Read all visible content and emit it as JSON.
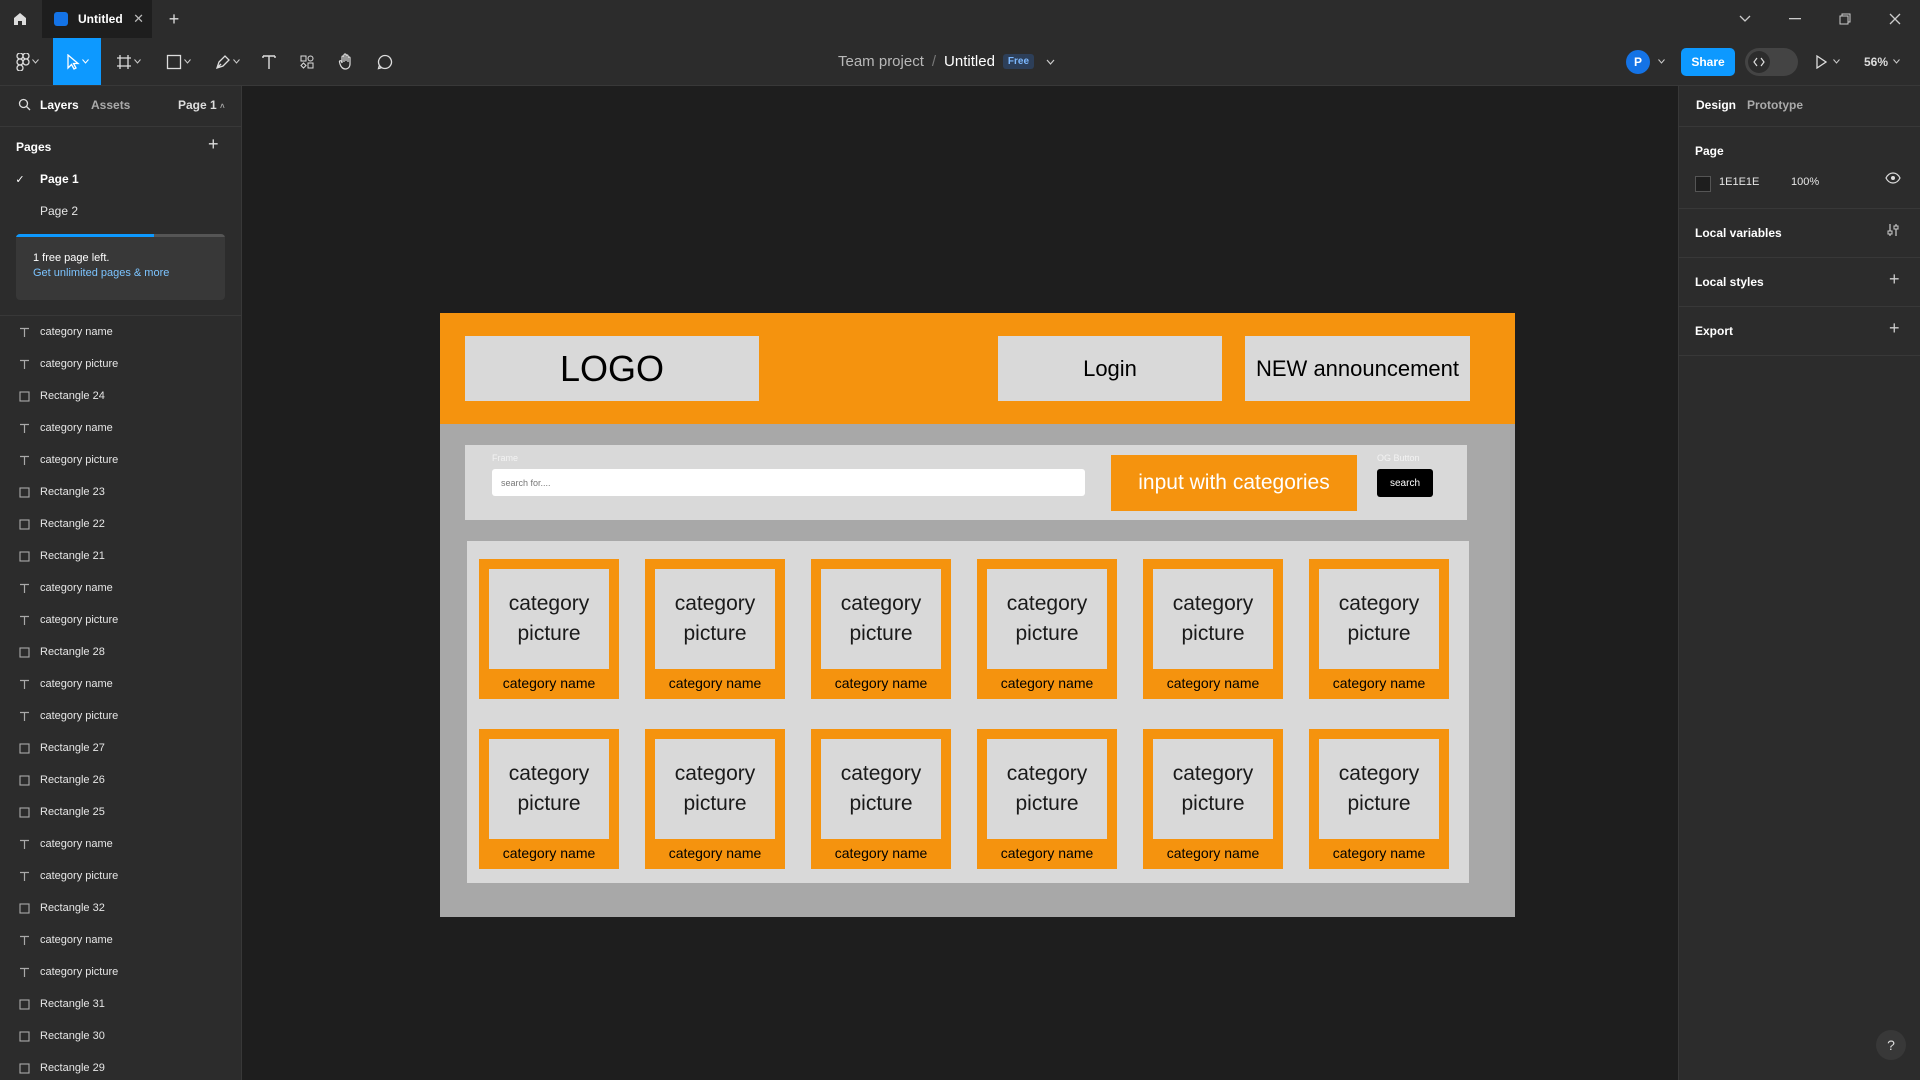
{
  "titlebar": {
    "tab_title": "Untitled"
  },
  "toolbar": {
    "team": "Team project",
    "separator": "/",
    "file_name": "Untitled",
    "plan_badge": "Free",
    "avatar_initial": "P",
    "share_label": "Share",
    "zoom": "56%"
  },
  "left_panel": {
    "tabs": {
      "layers": "Layers",
      "assets": "Assets",
      "page_selector": "Page 1"
    },
    "pages_title": "Pages",
    "pages": [
      {
        "label": "Page 1",
        "selected": true
      },
      {
        "label": "Page 2",
        "selected": false
      }
    ],
    "free_notice": {
      "line1": "1 free page left.",
      "link": "Get unlimited pages & more"
    },
    "layers": [
      {
        "type": "text",
        "label": "category name"
      },
      {
        "type": "text",
        "label": "category picture"
      },
      {
        "type": "rect",
        "label": "Rectangle 24"
      },
      {
        "type": "text",
        "label": "category name"
      },
      {
        "type": "text",
        "label": "category picture"
      },
      {
        "type": "rect",
        "label": "Rectangle 23"
      },
      {
        "type": "rect",
        "label": "Rectangle 22"
      },
      {
        "type": "rect",
        "label": "Rectangle 21"
      },
      {
        "type": "text",
        "label": "category name"
      },
      {
        "type": "text",
        "label": "category picture"
      },
      {
        "type": "rect",
        "label": "Rectangle 28"
      },
      {
        "type": "text",
        "label": "category name"
      },
      {
        "type": "text",
        "label": "category picture"
      },
      {
        "type": "rect",
        "label": "Rectangle 27"
      },
      {
        "type": "rect",
        "label": "Rectangle 26"
      },
      {
        "type": "rect",
        "label": "Rectangle 25"
      },
      {
        "type": "text",
        "label": "category name"
      },
      {
        "type": "text",
        "label": "category picture"
      },
      {
        "type": "rect",
        "label": "Rectangle 32"
      },
      {
        "type": "text",
        "label": "category name"
      },
      {
        "type": "text",
        "label": "category picture"
      },
      {
        "type": "rect",
        "label": "Rectangle 31"
      },
      {
        "type": "rect",
        "label": "Rectangle 30"
      },
      {
        "type": "rect",
        "label": "Rectangle 29"
      }
    ]
  },
  "right_panel": {
    "tabs": {
      "design": "Design",
      "prototype": "Prototype"
    },
    "page_heading": "Page",
    "page_color": "1E1E1E",
    "page_opacity": "100%",
    "local_variables": "Local variables",
    "local_styles": "Local styles",
    "export": "Export"
  },
  "canvas": {
    "header": {
      "logo": "LOGO",
      "login": "Login",
      "announcement": "NEW announcement"
    },
    "search": {
      "frame_label": "Frame",
      "placeholder": "search for....",
      "categories_input": "input with categories",
      "button_label_small": "OG Button",
      "button": "search"
    },
    "cards": [
      {
        "picture": "category picture",
        "name": "category name"
      },
      {
        "picture": "category picture",
        "name": "category name"
      },
      {
        "picture": "category picture",
        "name": "category name"
      },
      {
        "picture": "category picture",
        "name": "category name"
      },
      {
        "picture": "category picture",
        "name": "category name"
      },
      {
        "picture": "category picture",
        "name": "category name"
      },
      {
        "picture": "category picture",
        "name": "category name"
      },
      {
        "picture": "category picture",
        "name": "category name"
      },
      {
        "picture": "category picture",
        "name": "category name"
      },
      {
        "picture": "category picture",
        "name": "category name"
      },
      {
        "picture": "category picture",
        "name": "category name"
      },
      {
        "picture": "category picture",
        "name": "category name"
      }
    ]
  },
  "colors": {
    "accent": "#0d99ff",
    "orange": "#f5930e",
    "canvas_bg": "#1e1e1e"
  }
}
